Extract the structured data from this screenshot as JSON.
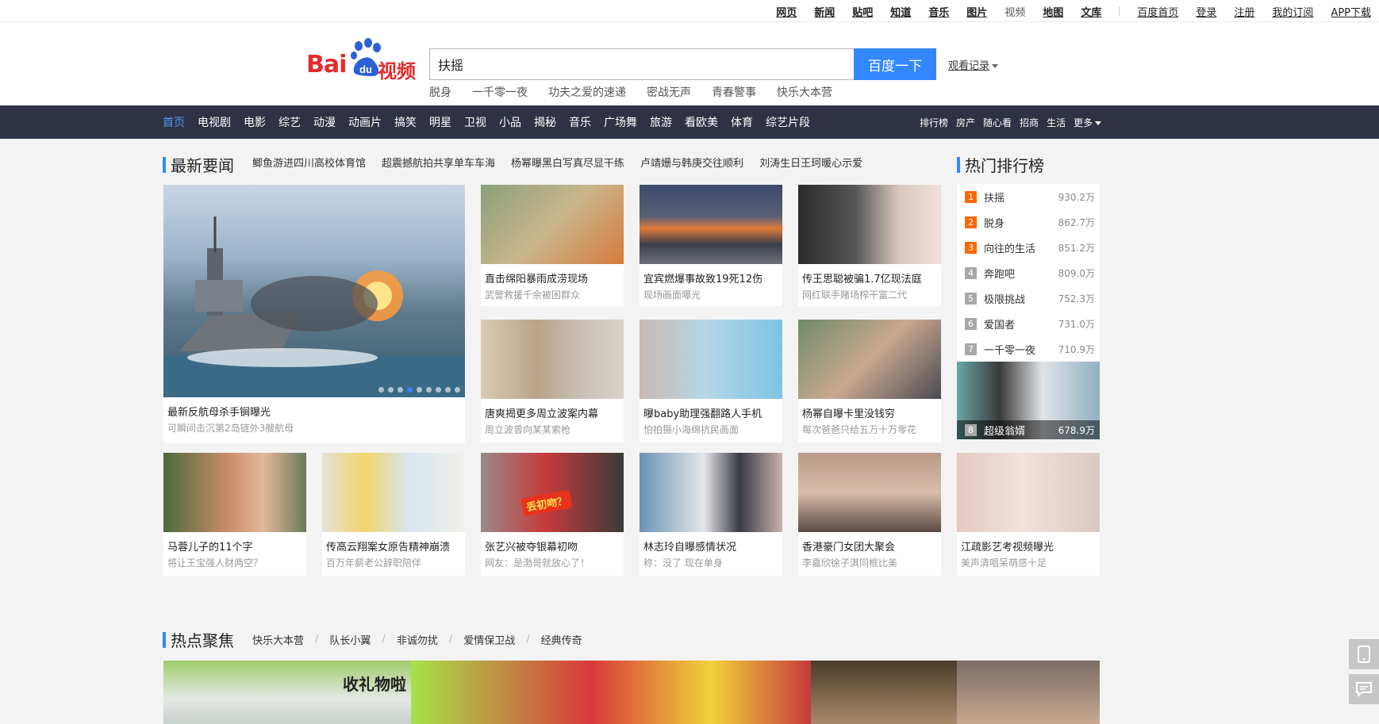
{
  "topbar": {
    "links": [
      "网页",
      "新闻",
      "贴吧",
      "知道",
      "音乐",
      "图片",
      "视频",
      "地图",
      "文库"
    ],
    "right_links": [
      "百度首页",
      "登录",
      "注册",
      "我的订阅",
      "APP下载"
    ]
  },
  "header": {
    "logo_bai": "Bai",
    "logo_du": "du",
    "logo_shipin": "视频",
    "search_value": "扶摇",
    "search_button": "百度一下",
    "history_label": "观看记录",
    "hotwords": [
      "脱身",
      "一千零一夜",
      "功夫之爱的速递",
      "密战无声",
      "青春警事",
      "快乐大本营"
    ]
  },
  "nav": {
    "items": [
      "首页",
      "电视剧",
      "电影",
      "综艺",
      "动漫",
      "动画片",
      "搞笑",
      "明星",
      "卫视",
      "小品",
      "揭秘",
      "音乐",
      "广场舞",
      "旅游",
      "看欧美",
      "体育",
      "综艺片段"
    ],
    "right_items": [
      "排行榜",
      "房产",
      "随心看",
      "招商",
      "生活",
      "更多"
    ]
  },
  "news": {
    "title": "最新要闻",
    "links": [
      "鲫鱼游进四川高校体育馆",
      "超震撼航拍共享单车车海",
      "杨幂曝黑白写真尽显干练",
      "卢靖姗与韩庚交往顺利",
      "刘涛生日王珂暖心示爱"
    ],
    "big": {
      "title": "最新反航母杀手锏曝光",
      "sub": "可瞬间击沉第2岛链外3艘航母"
    },
    "cards_top": [
      {
        "title": "直击绵阳暴雨成涝现场",
        "sub": "武警救援千余被困群众"
      },
      {
        "title": "宜宾燃爆事故致19死12伤",
        "sub": "现场画面曝光"
      },
      {
        "title": "传王思聪被骗1.7亿现法庭",
        "sub": "网红联手赌场榨干富二代"
      }
    ],
    "cards_mid": [
      {
        "title": "唐爽揭更多周立波案内幕",
        "sub": "周立波曾向某某索枪"
      },
      {
        "title": "曝baby助理强翻路人手机",
        "sub": "怕拍摄小海绵抗民画面"
      },
      {
        "title": "杨幂自曝卡里没钱穷",
        "sub": "每次爸爸只给五万十万零花"
      }
    ],
    "cards_bottom": [
      {
        "title": "马蓉儿子的11个字",
        "sub": "将让王宝强人财两空？"
      },
      {
        "title": "传高云翔案女原告精神崩溃",
        "sub": "百万年薪老公辞职陪伴"
      },
      {
        "title": "张艺兴被夺银幕初吻",
        "sub": "网友：是渤哥就放心了！"
      },
      {
        "title": "林志玲自曝感情状况",
        "sub": "称：没了 现在单身"
      },
      {
        "title": "香港豪门女团大聚会",
        "sub": "李嘉欣徐子淇同框比美"
      },
      {
        "title": "江疏影艺考视频曝光",
        "sub": "美声清唱呆萌感十足"
      }
    ],
    "kiss_tag": "丢初吻？"
  },
  "ranking": {
    "title": "热门排行榜",
    "items": [
      {
        "rank": "1",
        "name": "扶摇",
        "value": "930.2万",
        "color": "#ff6600"
      },
      {
        "rank": "2",
        "name": "脱身",
        "value": "862.7万",
        "color": "#ff6600"
      },
      {
        "rank": "3",
        "name": "向往的生活",
        "value": "851.2万",
        "color": "#ff6600"
      },
      {
        "rank": "4",
        "name": "奔跑吧",
        "value": "809.0万",
        "color": "#a8a8a8"
      },
      {
        "rank": "5",
        "name": "极限挑战",
        "value": "752.3万",
        "color": "#a8a8a8"
      },
      {
        "rank": "6",
        "name": "爱国者",
        "value": "731.0万",
        "color": "#a8a8a8"
      },
      {
        "rank": "7",
        "name": "一千零一夜",
        "value": "710.9万",
        "color": "#a8a8a8"
      }
    ],
    "featured": {
      "rank": "8",
      "name": "超级翁婿",
      "value": "678.9万"
    }
  },
  "hot_focus": {
    "title": "热点聚焦",
    "tabs": [
      "快乐大本营",
      "队长小翼",
      "非诚勿扰",
      "爱情保卫战",
      "经典传奇"
    ],
    "banner_text": "收礼物啦"
  },
  "colors": {
    "accent": "#3388ff",
    "nav_bg": "#2f3244",
    "logo_red": "#e52b2b",
    "rank_hot": "#ff6600"
  }
}
